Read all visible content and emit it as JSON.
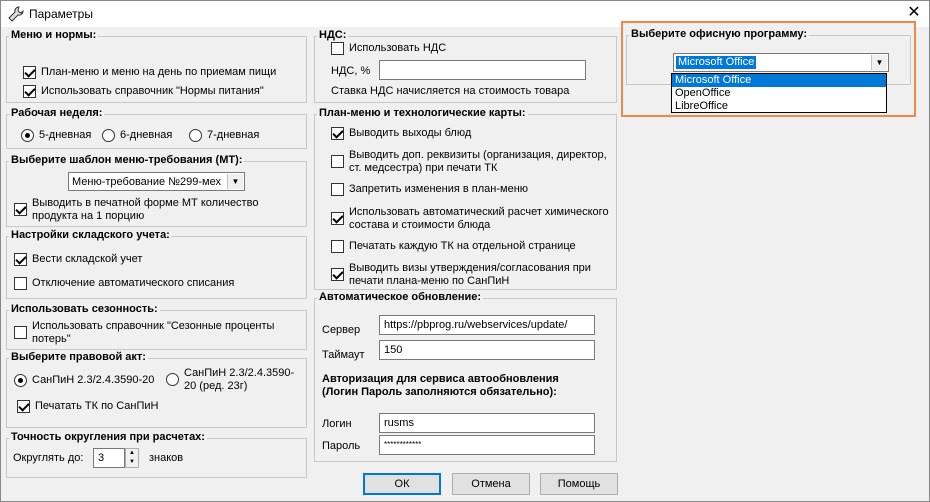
{
  "window": {
    "title": "Параметры",
    "close": "✕"
  },
  "menu_norms": {
    "title": "Меню и нормы:",
    "items": [
      {
        "label": "План-меню и меню на день по приемам пищи",
        "checked": true
      },
      {
        "label": "Использовать справочник \"Нормы питания\"",
        "checked": true
      }
    ]
  },
  "work_week": {
    "title": "Рабочая неделя:",
    "options": [
      "5-дневная",
      "6-дневная",
      "7-дневная"
    ],
    "selected": 0
  },
  "mt_template": {
    "title": "Выберите шаблон меню-требования (МТ):",
    "value": "Меню-требование №299-мех",
    "print_label": "Выводить в печатной форме МТ количество продукта на 1 порцию",
    "print_checked": true
  },
  "warehouse": {
    "title": "Настройки складского учета:",
    "items": [
      {
        "label": "Вести складской учет",
        "checked": true
      },
      {
        "label": "Отключение автоматического списания",
        "checked": false
      }
    ]
  },
  "seasonality": {
    "title": "Использовать сезонность:",
    "label": "Использовать справочник \"Сезонные проценты потерь\"",
    "checked": false
  },
  "legal_act": {
    "title": "Выберите правовой акт:",
    "option1": "СанПиН 2.3/2.4.3590-20",
    "option2": "СанПиН 2.3/2.4.3590-20 (ред. 23г)",
    "selected": 0,
    "print_label": "Печатать ТК по СанПиН",
    "print_checked": true
  },
  "rounding": {
    "title": "Точность округления при расчетах:",
    "prefix": "Округлять до:",
    "value": "3",
    "suffix": "знаков"
  },
  "vat": {
    "title": "НДС:",
    "use_label": "Использовать НДС",
    "use_checked": false,
    "rate_label": "НДС, %",
    "rate_value": "",
    "note": "Ставка НДС начисляется на стоимость товара"
  },
  "plan_menu": {
    "title": "План-меню и технологические карты:",
    "items": [
      {
        "label": "Выводить выходы блюд",
        "checked": true
      },
      {
        "label": "Выводить доп. реквизиты (организация, директор, ст. медсестра) при печати ТК",
        "checked": false
      },
      {
        "label": "Запретить изменения в план-меню",
        "checked": false
      },
      {
        "label": "Использовать автоматический расчет химического состава и стоимости блюда",
        "checked": true
      },
      {
        "label": "Печатать каждую ТК на отдельной странице",
        "checked": false
      },
      {
        "label": "Выводить визы утверждения/согласования при печати плана-меню по СанПиН",
        "checked": true
      }
    ]
  },
  "auto_update": {
    "title": "Автоматическое обновление:",
    "server_label": "Сервер",
    "server_value": "https://pbprog.ru/webservices/update/",
    "timeout_label": "Таймаут",
    "timeout_value": "150",
    "auth_note": "Авторизация для сервиса автообновления (Логин  Пароль заполняются обязательно):",
    "login_label": "Логин",
    "login_value": "rusms",
    "password_label": "Пароль",
    "password_value": "************"
  },
  "office": {
    "title": "Выберите офисную программу:",
    "selected": "Microsoft Office",
    "options": [
      "Microsoft Office",
      "OpenOffice",
      "LibreOffice"
    ]
  },
  "buttons": {
    "ok": "ОК",
    "cancel": "Отмена",
    "help": "Помощь"
  },
  "colors": {
    "highlight": "#ef8a46",
    "selection": "#0078d7"
  }
}
